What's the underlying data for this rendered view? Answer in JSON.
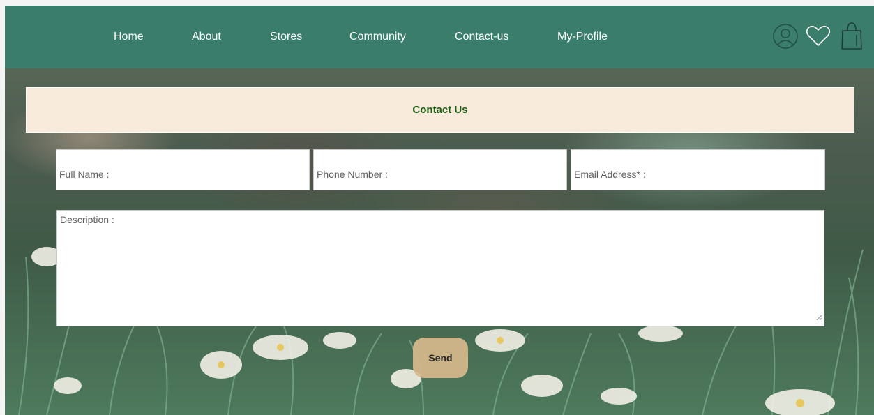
{
  "nav": {
    "items": [
      {
        "label": "Home"
      },
      {
        "label": "About"
      },
      {
        "label": "Stores"
      },
      {
        "label": "Community"
      },
      {
        "label": "Contact-us"
      },
      {
        "label": "My-Profile"
      }
    ],
    "icons": [
      "user-icon",
      "heart-icon",
      "shopping-bag-icon"
    ],
    "background_color": "#3b7d6b"
  },
  "contact": {
    "title": "Contact Us",
    "title_color": "#1c5c13",
    "panel_color": "#f8ebdc"
  },
  "form": {
    "full_name_placeholder": "Full Name :",
    "phone_placeholder": "Phone Number :",
    "email_placeholder": "Email Address* :",
    "description_placeholder": "Description :",
    "send_label": "Send",
    "send_color": "#d8b98c"
  }
}
